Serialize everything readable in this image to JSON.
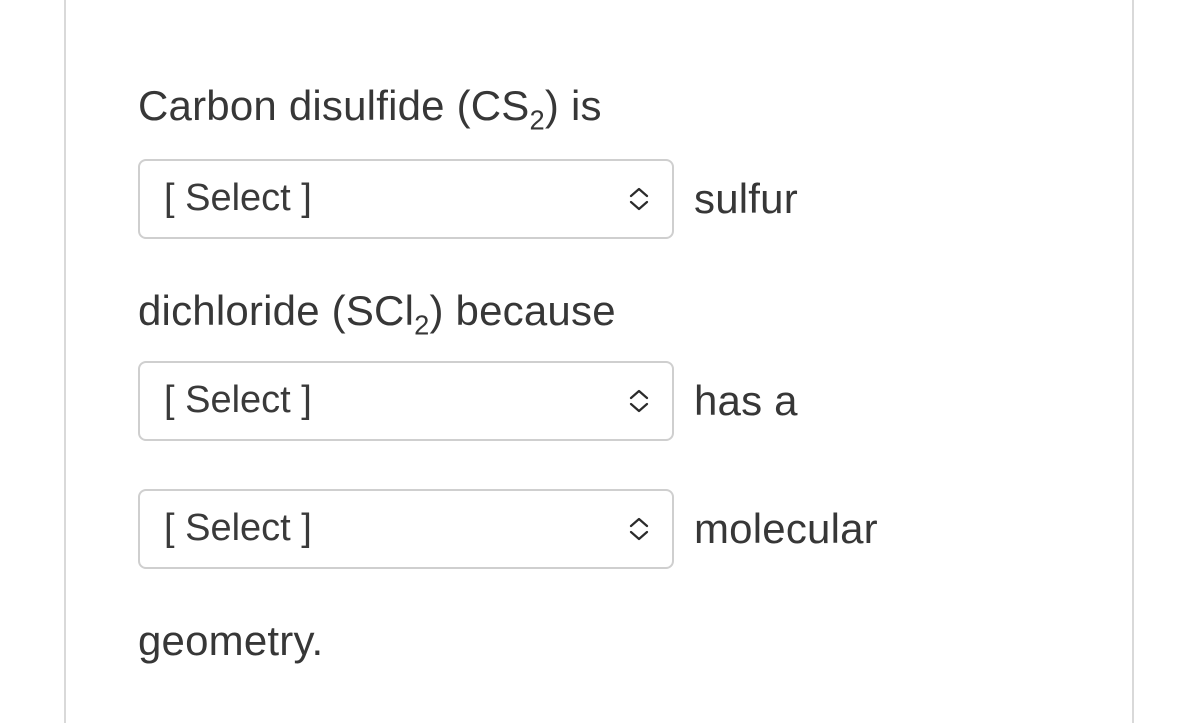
{
  "question": {
    "line1_pre": "Carbon disulfide (CS",
    "line1_sub": "2",
    "line1_post": ") is",
    "select_placeholder": "[ Select ]",
    "after1": "sulfur",
    "line2_pre": "dichloride (SCl",
    "line2_sub": "2",
    "line2_post": ") because",
    "after2": "has a",
    "after3": "molecular",
    "line3": "geometry."
  }
}
